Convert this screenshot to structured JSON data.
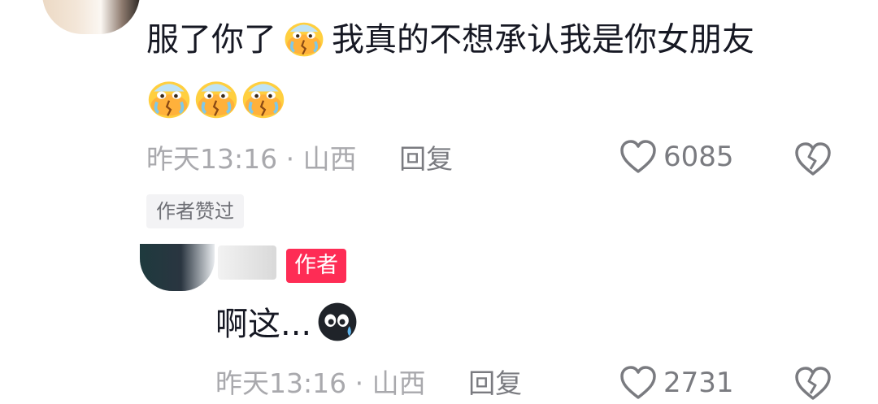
{
  "comment": {
    "text_part1": "服了你了",
    "text_part2": "我真的不想承认我是你女朋友",
    "emoji_icon": "sweating-crying-face-emoji",
    "time": "昨天13:16",
    "separator": "·",
    "location": "山西",
    "reply_label": "回复",
    "likes": "6085",
    "author_liked_badge": "作者赞过"
  },
  "reply": {
    "author_badge": "作者",
    "text": "啊这...",
    "emoji_icon": "sweat-drop-face-emoji",
    "time": "昨天13:16",
    "separator": "·",
    "location": "山西",
    "reply_label": "回复",
    "likes": "2731"
  },
  "colors": {
    "text": "#161823",
    "meta": "#a9a9ad",
    "author_badge_bg": "#fe2c55"
  }
}
